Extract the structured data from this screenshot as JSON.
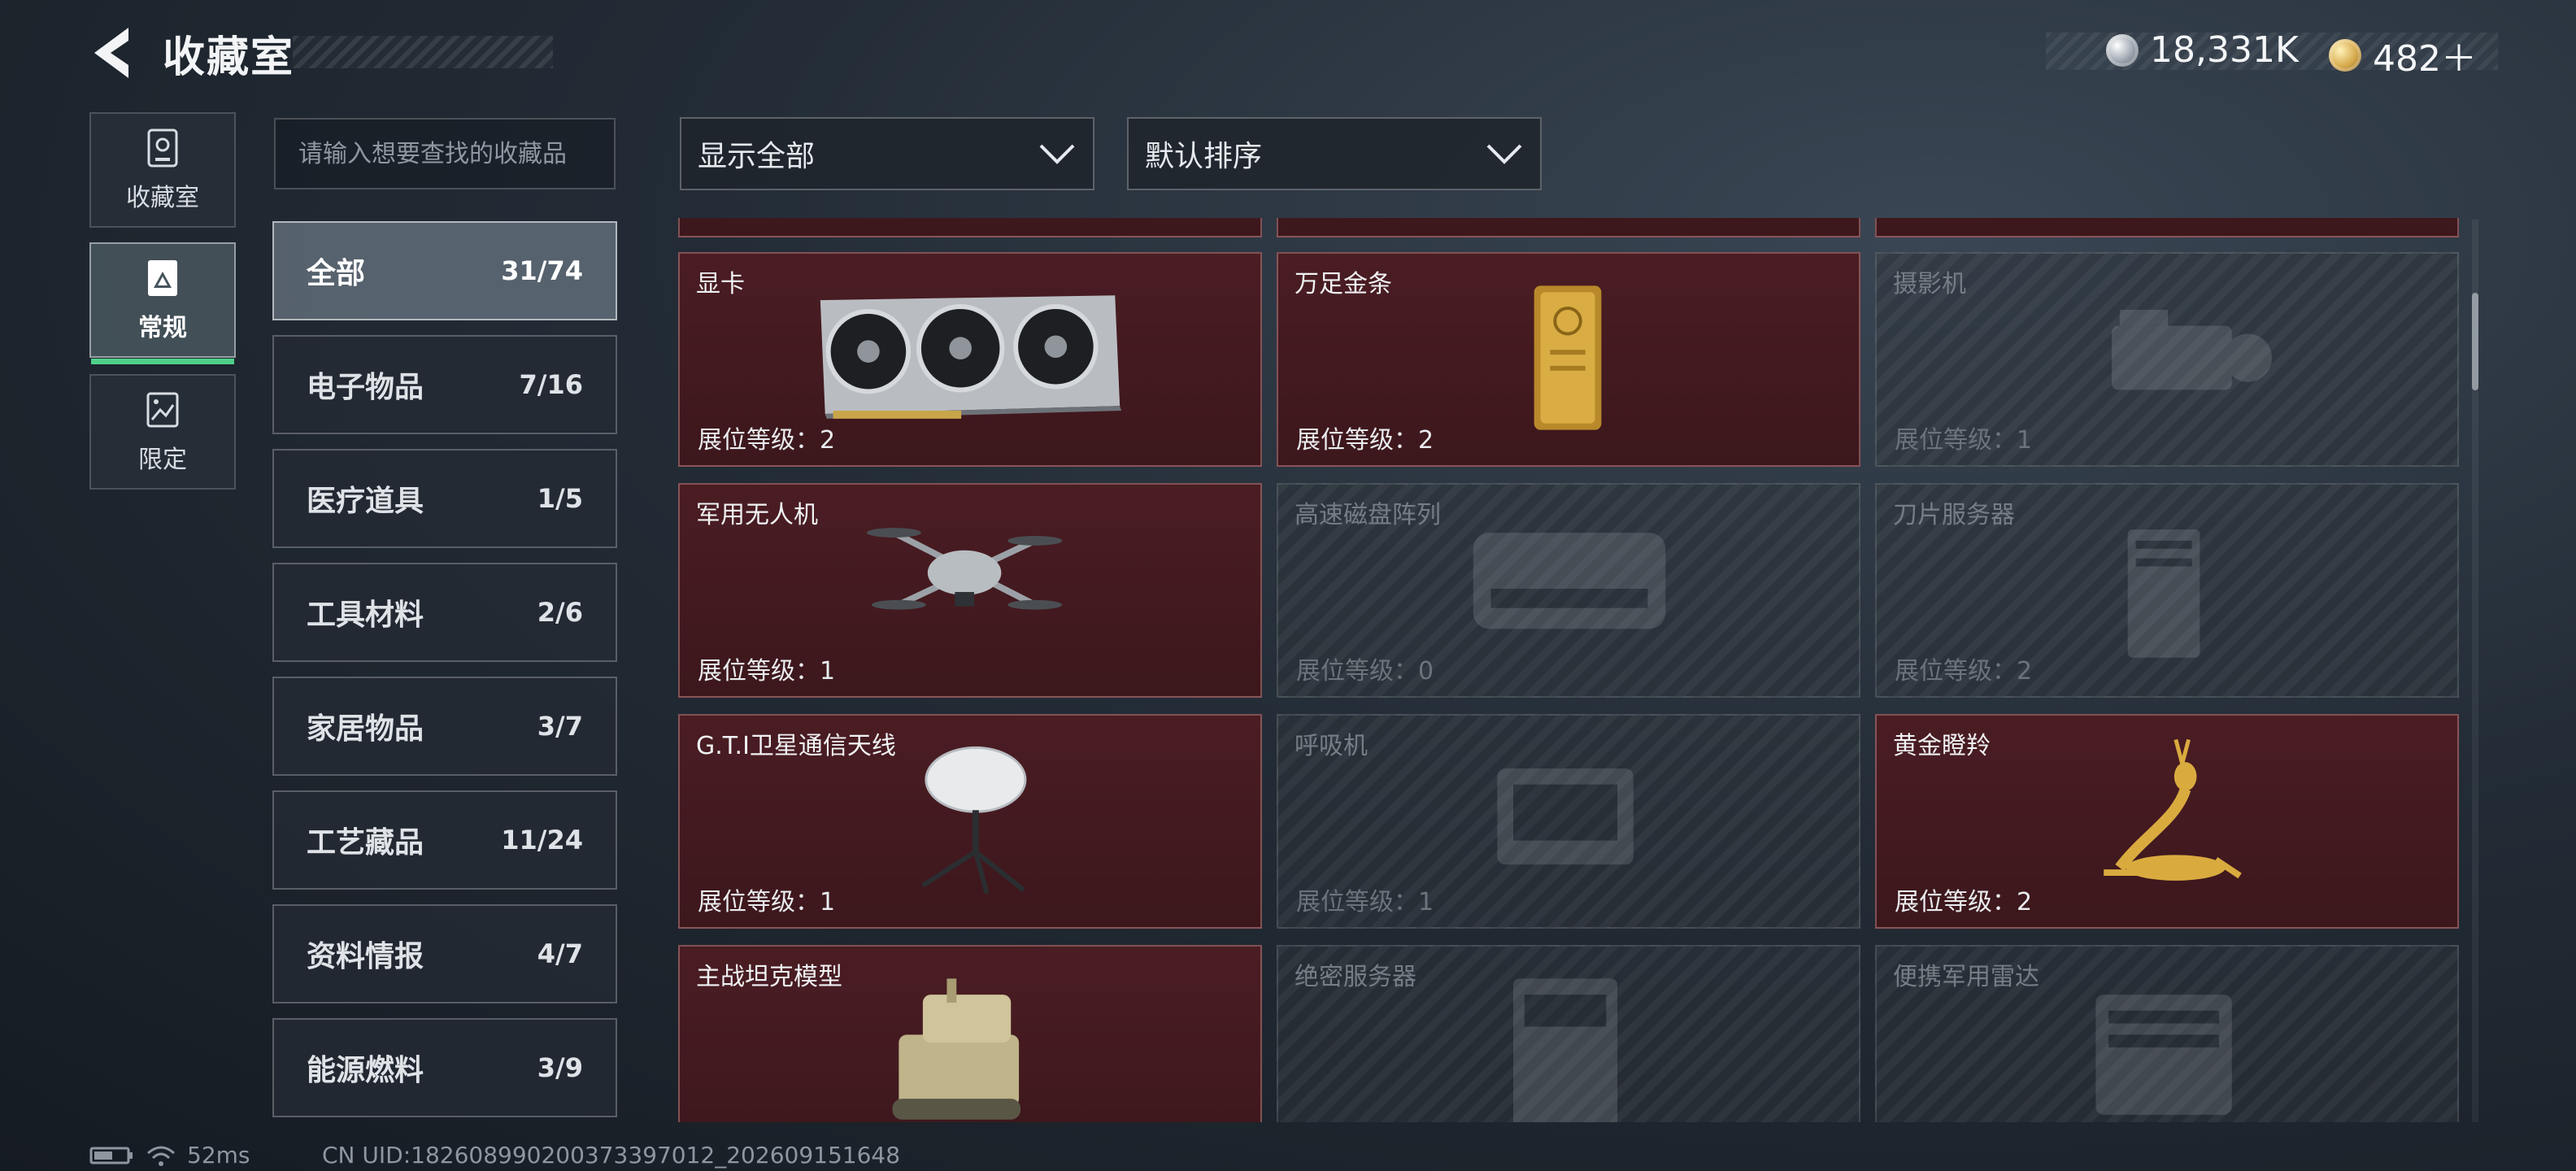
{
  "header": {
    "title": "收藏室",
    "currency": [
      {
        "icon": "silver-coin-icon",
        "value": "18,331K"
      },
      {
        "icon": "gold-coin-icon",
        "value": "482＋"
      }
    ]
  },
  "mode_tabs": [
    {
      "label": "收藏室",
      "icon": "vault-icon",
      "active": false
    },
    {
      "label": "常规",
      "icon": "picture-icon",
      "active": true
    },
    {
      "label": "限定",
      "icon": "limited-image-icon",
      "active": false
    }
  ],
  "search": {
    "placeholder": "请输入想要查找的收藏品"
  },
  "filters": {
    "show": "显示全部",
    "sort": "默认排序"
  },
  "categories": [
    {
      "name": "全部",
      "count": "31/74",
      "active": true
    },
    {
      "name": "电子物品",
      "count": "7/16"
    },
    {
      "name": "医疗道具",
      "count": "1/5"
    },
    {
      "name": "工具材料",
      "count": "2/6"
    },
    {
      "name": "家居物品",
      "count": "3/7"
    },
    {
      "name": "工艺藏品",
      "count": "11/24"
    },
    {
      "name": "资料情报",
      "count": "4/7"
    },
    {
      "name": "能源燃料",
      "count": "3/9"
    }
  ],
  "level_label": "展位等级：",
  "items": [
    {
      "name": "显卡",
      "level": "2",
      "collected": true,
      "icon": "graphics-card-icon"
    },
    {
      "name": "万足金条",
      "level": "2",
      "collected": true,
      "icon": "gold-bar-icon"
    },
    {
      "name": "摄影机",
      "level": "1",
      "collected": false,
      "icon": "camera-icon"
    },
    {
      "name": "军用无人机",
      "level": "1",
      "collected": true,
      "icon": "drone-icon"
    },
    {
      "name": "高速磁盘阵列",
      "level": "0",
      "collected": false,
      "icon": "disk-array-icon"
    },
    {
      "name": "刀片服务器",
      "level": "2",
      "collected": false,
      "icon": "blade-server-icon"
    },
    {
      "name": "G.T.I卫星通信天线",
      "level": "1",
      "collected": true,
      "icon": "satellite-antenna-icon"
    },
    {
      "name": "呼吸机",
      "level": "1",
      "collected": false,
      "icon": "ventilator-icon"
    },
    {
      "name": "黄金瞪羚",
      "level": "2",
      "collected": true,
      "icon": "golden-gazelle-icon"
    },
    {
      "name": "主战坦克模型",
      "level": "",
      "collected": true,
      "icon": "tank-model-icon"
    },
    {
      "name": "绝密服务器",
      "level": "",
      "collected": false,
      "icon": "secret-server-icon"
    },
    {
      "name": "便携军用雷达",
      "level": "",
      "collected": false,
      "icon": "portable-radar-icon"
    }
  ],
  "footer": {
    "ping": "52ms",
    "uid": "CN UID:1826089902003733970‌12_202609151648"
  },
  "colors": {
    "accent": "#4ed08a",
    "collected_card": "#4a1d23",
    "locked_card": "#3a4046"
  }
}
